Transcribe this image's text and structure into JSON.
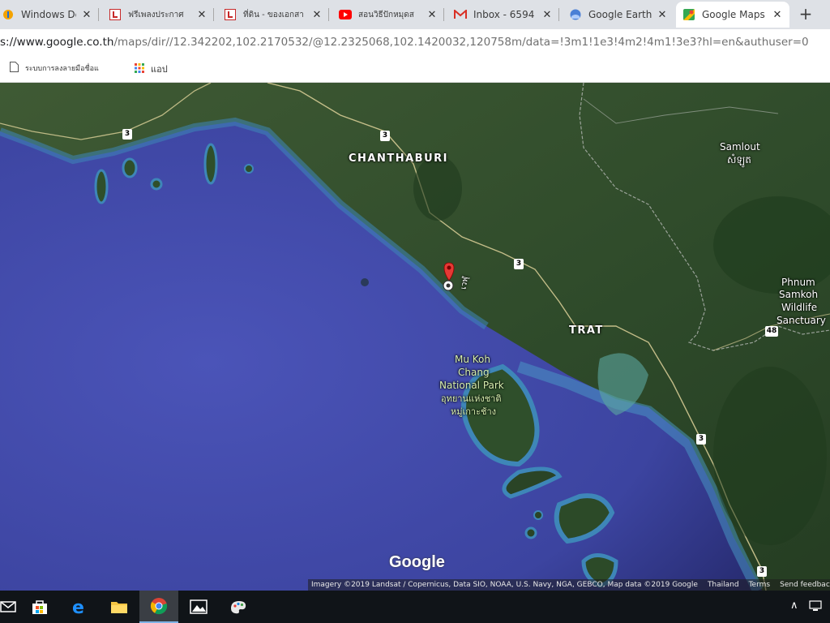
{
  "browser": {
    "tabs": [
      {
        "title": "Windows Defe",
        "icon": "windows-defender-icon"
      },
      {
        "title": "ฟรีเพลงประกาศ",
        "icon": "red-l-site-icon"
      },
      {
        "title": "ที่ดิน - ของเอกสา",
        "icon": "red-l-site-icon"
      },
      {
        "title": "สอนวิธีปักหมุดส",
        "icon": "youtube-icon"
      },
      {
        "title": "Inbox - 6594",
        "icon": "gmail-icon"
      },
      {
        "title": "Google Earth",
        "icon": "google-earth-icon"
      },
      {
        "title": "Google Maps",
        "icon": "google-maps-icon",
        "active": true
      }
    ],
    "close_glyph": "✕",
    "new_tab_glyph": "+",
    "url_host": "s://www.google.co.th",
    "url_rest": "/maps/dir//12.342202,102.2170532/@12.2325068,102.1420032,120758m/data=!3m1!1e3!4m2!4m1!3e3?hl=en&authuser=0",
    "bookmarks": [
      {
        "label": "ระบบการลงลายมือชื่อแ",
        "icon": "page-icon"
      },
      {
        "label": "แอป",
        "icon": "apps-grid-icon"
      }
    ]
  },
  "map": {
    "places": {
      "chanthaburi": "CHANTHABURI",
      "trat": "TRAT",
      "samlout": "Samlout",
      "samlout_khmer": "សំឡូត",
      "phnum1": "Phnum",
      "phnum2": "Samkoh",
      "phnum3": "Wildlife",
      "phnum4": "Sanctuary",
      "park1": "Mu Koh",
      "park2": "Chang",
      "park3": "National Park",
      "park4": "อุทยานแห่งชาติ",
      "park5": "หมู่เกาะช้าง",
      "river": "เวฬุ"
    },
    "routes": {
      "r1a": "3",
      "r1b": "3",
      "r1c": "3",
      "r1d": "3",
      "r1e": "3",
      "r48": "48"
    },
    "logo": "Google",
    "attribution": {
      "imagery": "Imagery ©2019 Landsat / Copernicus, Data SIO, NOAA, U.S. Navy, NGA, GEBCO, Map data ©2019 Google",
      "country": "Thailand",
      "terms": "Terms",
      "feedback": "Send feedback"
    },
    "colors": {
      "sea": "#3a3f9a",
      "land": "#2f4a2a",
      "pin": "#e53935"
    }
  },
  "taskbar": {
    "items": [
      "mail-icon",
      "store-icon",
      "edge-icon",
      "file-explorer-icon",
      "chrome-icon",
      "photos-icon",
      "paint-icon"
    ],
    "tray": "∧"
  }
}
